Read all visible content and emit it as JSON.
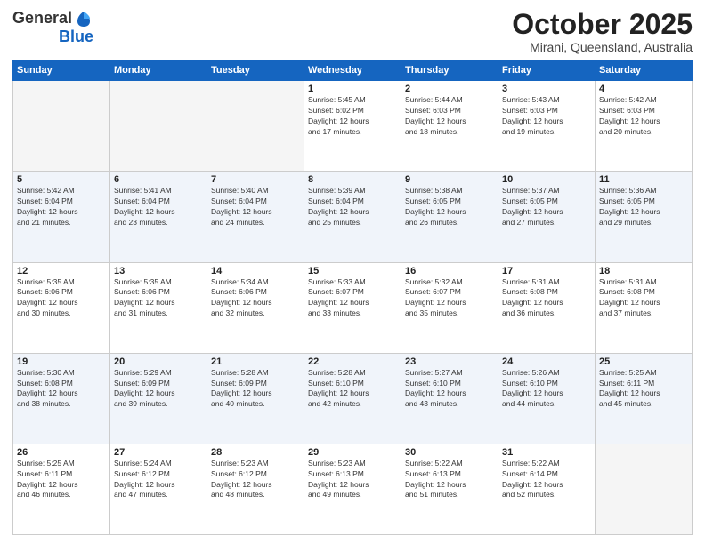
{
  "logo": {
    "general": "General",
    "blue": "Blue"
  },
  "header": {
    "title": "October 2025",
    "subtitle": "Mirani, Queensland, Australia"
  },
  "weekdays": [
    "Sunday",
    "Monday",
    "Tuesday",
    "Wednesday",
    "Thursday",
    "Friday",
    "Saturday"
  ],
  "weeks": [
    [
      {
        "day": "",
        "info": ""
      },
      {
        "day": "",
        "info": ""
      },
      {
        "day": "",
        "info": ""
      },
      {
        "day": "1",
        "info": "Sunrise: 5:45 AM\nSunset: 6:02 PM\nDaylight: 12 hours\nand 17 minutes."
      },
      {
        "day": "2",
        "info": "Sunrise: 5:44 AM\nSunset: 6:03 PM\nDaylight: 12 hours\nand 18 minutes."
      },
      {
        "day": "3",
        "info": "Sunrise: 5:43 AM\nSunset: 6:03 PM\nDaylight: 12 hours\nand 19 minutes."
      },
      {
        "day": "4",
        "info": "Sunrise: 5:42 AM\nSunset: 6:03 PM\nDaylight: 12 hours\nand 20 minutes."
      }
    ],
    [
      {
        "day": "5",
        "info": "Sunrise: 5:42 AM\nSunset: 6:04 PM\nDaylight: 12 hours\nand 21 minutes."
      },
      {
        "day": "6",
        "info": "Sunrise: 5:41 AM\nSunset: 6:04 PM\nDaylight: 12 hours\nand 23 minutes."
      },
      {
        "day": "7",
        "info": "Sunrise: 5:40 AM\nSunset: 6:04 PM\nDaylight: 12 hours\nand 24 minutes."
      },
      {
        "day": "8",
        "info": "Sunrise: 5:39 AM\nSunset: 6:04 PM\nDaylight: 12 hours\nand 25 minutes."
      },
      {
        "day": "9",
        "info": "Sunrise: 5:38 AM\nSunset: 6:05 PM\nDaylight: 12 hours\nand 26 minutes."
      },
      {
        "day": "10",
        "info": "Sunrise: 5:37 AM\nSunset: 6:05 PM\nDaylight: 12 hours\nand 27 minutes."
      },
      {
        "day": "11",
        "info": "Sunrise: 5:36 AM\nSunset: 6:05 PM\nDaylight: 12 hours\nand 29 minutes."
      }
    ],
    [
      {
        "day": "12",
        "info": "Sunrise: 5:35 AM\nSunset: 6:06 PM\nDaylight: 12 hours\nand 30 minutes."
      },
      {
        "day": "13",
        "info": "Sunrise: 5:35 AM\nSunset: 6:06 PM\nDaylight: 12 hours\nand 31 minutes."
      },
      {
        "day": "14",
        "info": "Sunrise: 5:34 AM\nSunset: 6:06 PM\nDaylight: 12 hours\nand 32 minutes."
      },
      {
        "day": "15",
        "info": "Sunrise: 5:33 AM\nSunset: 6:07 PM\nDaylight: 12 hours\nand 33 minutes."
      },
      {
        "day": "16",
        "info": "Sunrise: 5:32 AM\nSunset: 6:07 PM\nDaylight: 12 hours\nand 35 minutes."
      },
      {
        "day": "17",
        "info": "Sunrise: 5:31 AM\nSunset: 6:08 PM\nDaylight: 12 hours\nand 36 minutes."
      },
      {
        "day": "18",
        "info": "Sunrise: 5:31 AM\nSunset: 6:08 PM\nDaylight: 12 hours\nand 37 minutes."
      }
    ],
    [
      {
        "day": "19",
        "info": "Sunrise: 5:30 AM\nSunset: 6:08 PM\nDaylight: 12 hours\nand 38 minutes."
      },
      {
        "day": "20",
        "info": "Sunrise: 5:29 AM\nSunset: 6:09 PM\nDaylight: 12 hours\nand 39 minutes."
      },
      {
        "day": "21",
        "info": "Sunrise: 5:28 AM\nSunset: 6:09 PM\nDaylight: 12 hours\nand 40 minutes."
      },
      {
        "day": "22",
        "info": "Sunrise: 5:28 AM\nSunset: 6:10 PM\nDaylight: 12 hours\nand 42 minutes."
      },
      {
        "day": "23",
        "info": "Sunrise: 5:27 AM\nSunset: 6:10 PM\nDaylight: 12 hours\nand 43 minutes."
      },
      {
        "day": "24",
        "info": "Sunrise: 5:26 AM\nSunset: 6:10 PM\nDaylight: 12 hours\nand 44 minutes."
      },
      {
        "day": "25",
        "info": "Sunrise: 5:25 AM\nSunset: 6:11 PM\nDaylight: 12 hours\nand 45 minutes."
      }
    ],
    [
      {
        "day": "26",
        "info": "Sunrise: 5:25 AM\nSunset: 6:11 PM\nDaylight: 12 hours\nand 46 minutes."
      },
      {
        "day": "27",
        "info": "Sunrise: 5:24 AM\nSunset: 6:12 PM\nDaylight: 12 hours\nand 47 minutes."
      },
      {
        "day": "28",
        "info": "Sunrise: 5:23 AM\nSunset: 6:12 PM\nDaylight: 12 hours\nand 48 minutes."
      },
      {
        "day": "29",
        "info": "Sunrise: 5:23 AM\nSunset: 6:13 PM\nDaylight: 12 hours\nand 49 minutes."
      },
      {
        "day": "30",
        "info": "Sunrise: 5:22 AM\nSunset: 6:13 PM\nDaylight: 12 hours\nand 51 minutes."
      },
      {
        "day": "31",
        "info": "Sunrise: 5:22 AM\nSunset: 6:14 PM\nDaylight: 12 hours\nand 52 minutes."
      },
      {
        "day": "",
        "info": ""
      }
    ]
  ]
}
